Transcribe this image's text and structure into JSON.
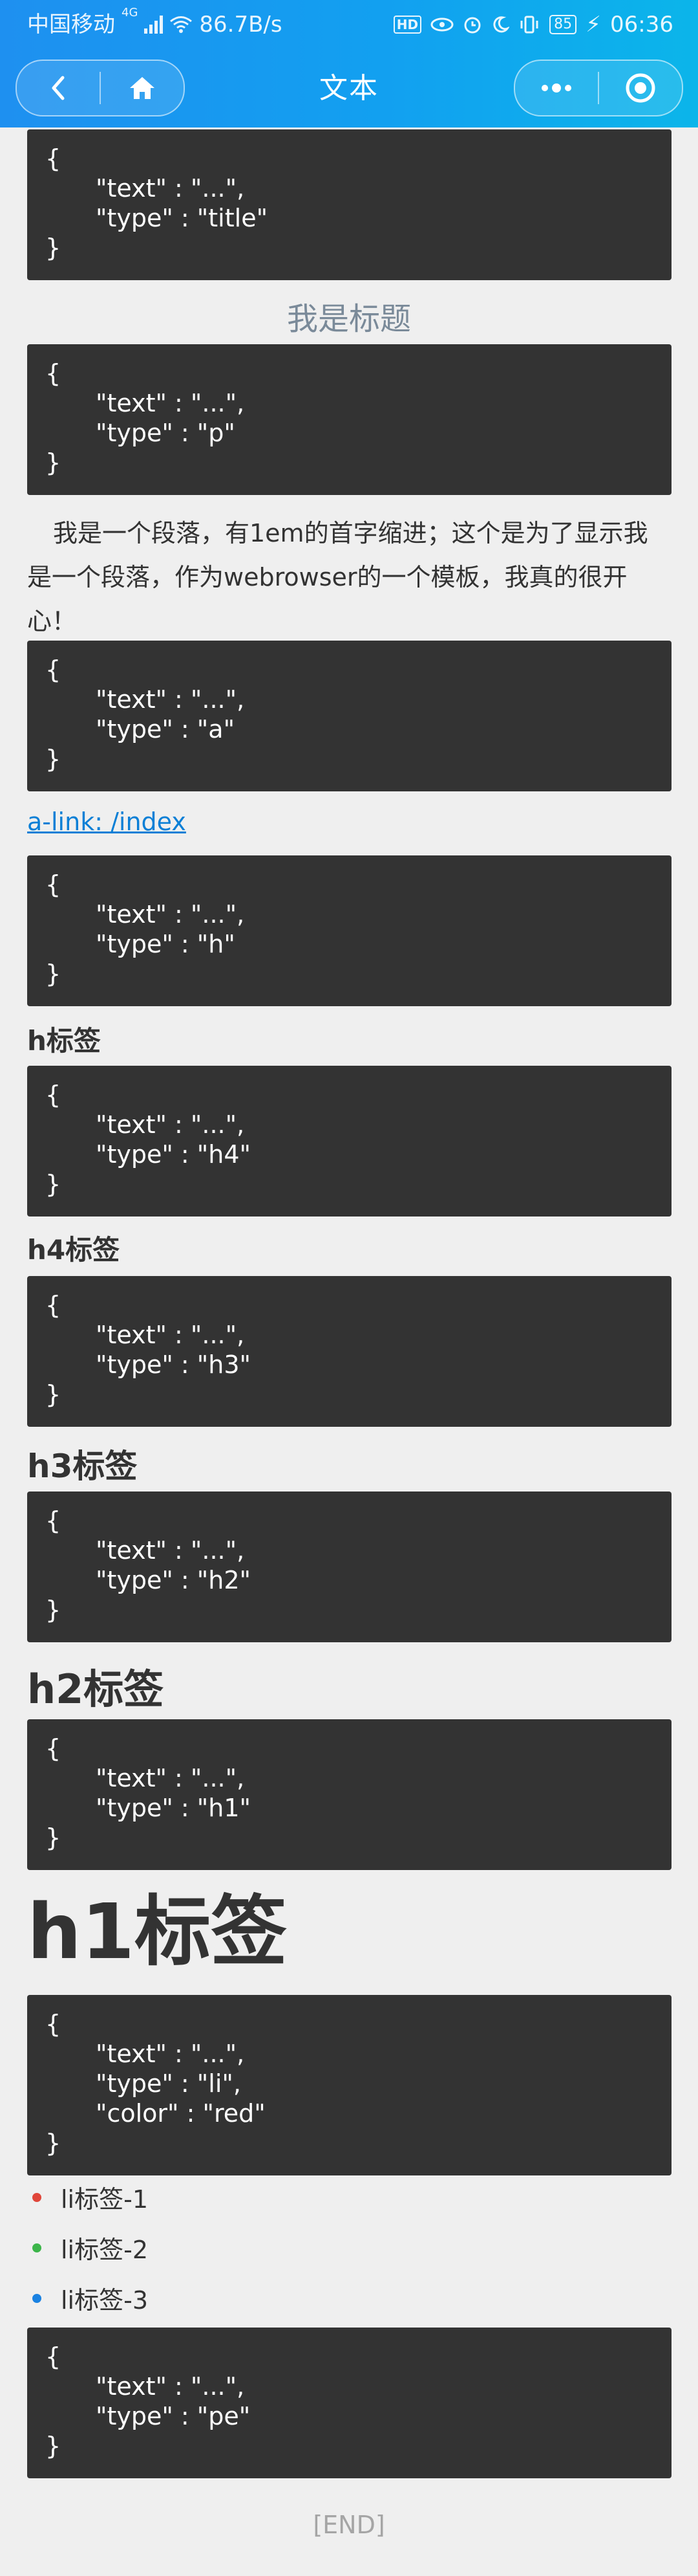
{
  "status_bar": {
    "carrier": "中国移动",
    "network": "4G",
    "speed": "86.7B/s",
    "hd": "HD",
    "battery": "85",
    "time": "06:36"
  },
  "navbar": {
    "title": "文本",
    "back_icon": "chevron-left-icon",
    "home_icon": "home-icon",
    "more_icon": "more-dots-icon",
    "target_icon": "record-circle-icon"
  },
  "blocks": {
    "b1": {
      "open": "{",
      "text_line": "\"text\" : \"...\",",
      "type_line": "\"type\" : \"title\"",
      "close": "}"
    },
    "b2": {
      "open": "{",
      "text_line": "\"text\" : \"...\",",
      "type_line": "\"type\" : \"p\"",
      "close": "}"
    },
    "b3": {
      "open": "{",
      "text_line": "\"text\" : \"...\",",
      "type_line": "\"type\" : \"a\"",
      "close": "}"
    },
    "b4": {
      "open": "{",
      "text_line": "\"text\" : \"...\",",
      "type_line": "\"type\" : \"h\"",
      "close": "}"
    },
    "b5": {
      "open": "{",
      "text_line": "\"text\" : \"...\",",
      "type_line": "\"type\" : \"h4\"",
      "close": "}"
    },
    "b6": {
      "open": "{",
      "text_line": "\"text\" : \"...\",",
      "type_line": "\"type\" : \"h3\"",
      "close": "}"
    },
    "b7": {
      "open": "{",
      "text_line": "\"text\" : \"...\",",
      "type_line": "\"type\" : \"h2\"",
      "close": "}"
    },
    "b8": {
      "open": "{",
      "text_line": "\"text\" : \"...\",",
      "type_line": "\"type\" : \"h1\"",
      "close": "}"
    },
    "b9": {
      "open": "{",
      "text_line": "\"text\" : \"...\",",
      "type_line": "\"type\" : \"li\",",
      "color_line": "\"color\" : \"red\"",
      "close": "}"
    },
    "b10": {
      "open": "{",
      "text_line": "\"text\" : \"...\",",
      "type_line": "\"type\" : \"pe\"",
      "close": "}"
    }
  },
  "content": {
    "title": "我是标题",
    "paragraph": "我是一个段落，有1em的首字缩进；这个是为了显示我是一个段落，作为webrowser的一个模板，我真的很开心！",
    "link": "a-link: /index",
    "h": "h标签",
    "h4": "h4标签",
    "h3": "h3标签",
    "h2": "h2标签",
    "h1": "h1标签",
    "list": [
      {
        "label": "li标签-1",
        "color": "#e0463a"
      },
      {
        "label": "li标签-2",
        "color": "#3cb54a"
      },
      {
        "label": "li标签-3",
        "color": "#1a82e2"
      }
    ],
    "end": "[END]"
  }
}
